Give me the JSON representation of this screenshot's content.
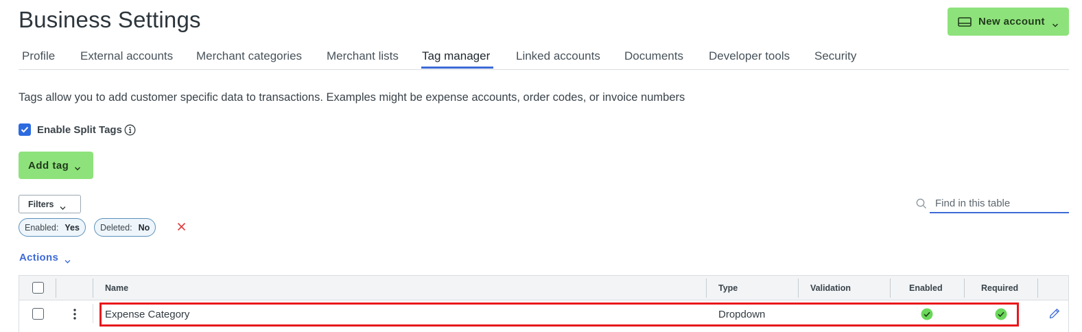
{
  "page": {
    "title": "Business Settings",
    "description": "Tags allow you to add customer specific data to transactions. Examples might be expense accounts, order codes, or invoice numbers"
  },
  "header": {
    "new_account_label": "New account"
  },
  "tabs": [
    {
      "label": "Profile",
      "active": false
    },
    {
      "label": "External accounts",
      "active": false
    },
    {
      "label": "Merchant categories",
      "active": false
    },
    {
      "label": "Merchant lists",
      "active": false
    },
    {
      "label": "Tag manager",
      "active": true
    },
    {
      "label": "Linked accounts",
      "active": false
    },
    {
      "label": "Documents",
      "active": false
    },
    {
      "label": "Developer tools",
      "active": false
    },
    {
      "label": "Security",
      "active": false
    }
  ],
  "split_tags": {
    "label": "Enable Split Tags",
    "checked": true
  },
  "add_tag": {
    "label": "Add tag"
  },
  "filters": {
    "label": "Filters",
    "chips": [
      {
        "key": "Enabled:",
        "value": "Yes"
      },
      {
        "key": "Deleted:",
        "value": "No"
      }
    ]
  },
  "search": {
    "placeholder": "Find in this table"
  },
  "actions": {
    "label": "Actions"
  },
  "table": {
    "columns": [
      "Name",
      "Type",
      "Validation",
      "Enabled",
      "Required"
    ],
    "rows": [
      {
        "name": "Expense Category",
        "type": "Dropdown",
        "validation": "",
        "enabled": true,
        "required": true
      }
    ]
  },
  "colors": {
    "primary_button": "#8ee27b",
    "accent_blue": "#3d6ad6",
    "check_green": "#6bd75b",
    "highlight_red": "#e8161b"
  },
  "icons": {
    "new_account": "card-icon",
    "info": "info-icon",
    "search": "search-icon",
    "row_menu": "kebab-icon",
    "edit": "pencil-icon",
    "status": "check-circle-icon",
    "clear": "close-icon"
  }
}
